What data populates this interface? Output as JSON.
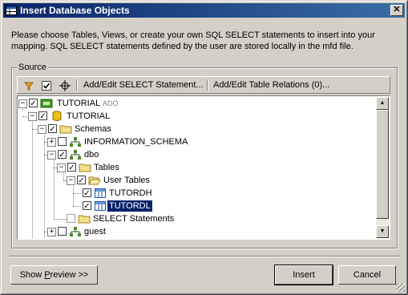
{
  "window": {
    "title": "Insert Database Objects",
    "close_label": "✕"
  },
  "instructions": {
    "line1": "Please choose Tables, Views, or create your own SQL SELECT statements to insert into your",
    "line2": "mapping.  SQL SELECT statements defined by the user are stored locally in the mfd file."
  },
  "source_group": {
    "label": "Source"
  },
  "toolbar": {
    "filter_icon": "filter-icon",
    "check_icon": "checked-objects-icon",
    "locate_icon": "crosshair-icon",
    "add_edit_select": "Add/Edit SELECT Statement...",
    "add_edit_relations": "Add/Edit Table Relations (0)..."
  },
  "tree": {
    "root": {
      "label": "TUTORIAL",
      "suffix": "ADO"
    },
    "database": "TUTORIAL",
    "schemas": "Schemas",
    "info_schema": "INFORMATION_SCHEMA",
    "dbo": "dbo",
    "tables": "Tables",
    "user_tables": "User Tables",
    "table1": "TUTORDH",
    "table2": "TUTORDL",
    "select_statements": "SELECT Statements",
    "guest": "guest"
  },
  "buttons": {
    "show_preview_pre": "Show ",
    "show_preview_u": "P",
    "show_preview_post": "review >>",
    "insert": "Insert",
    "cancel": "Cancel"
  },
  "colors": {
    "title_start": "#0a246a",
    "title_end": "#3a6ea5",
    "selection": "#0a246a",
    "face": "#d4d0c8",
    "folder": "#f5e08a",
    "schema": "#4a8a2a"
  }
}
